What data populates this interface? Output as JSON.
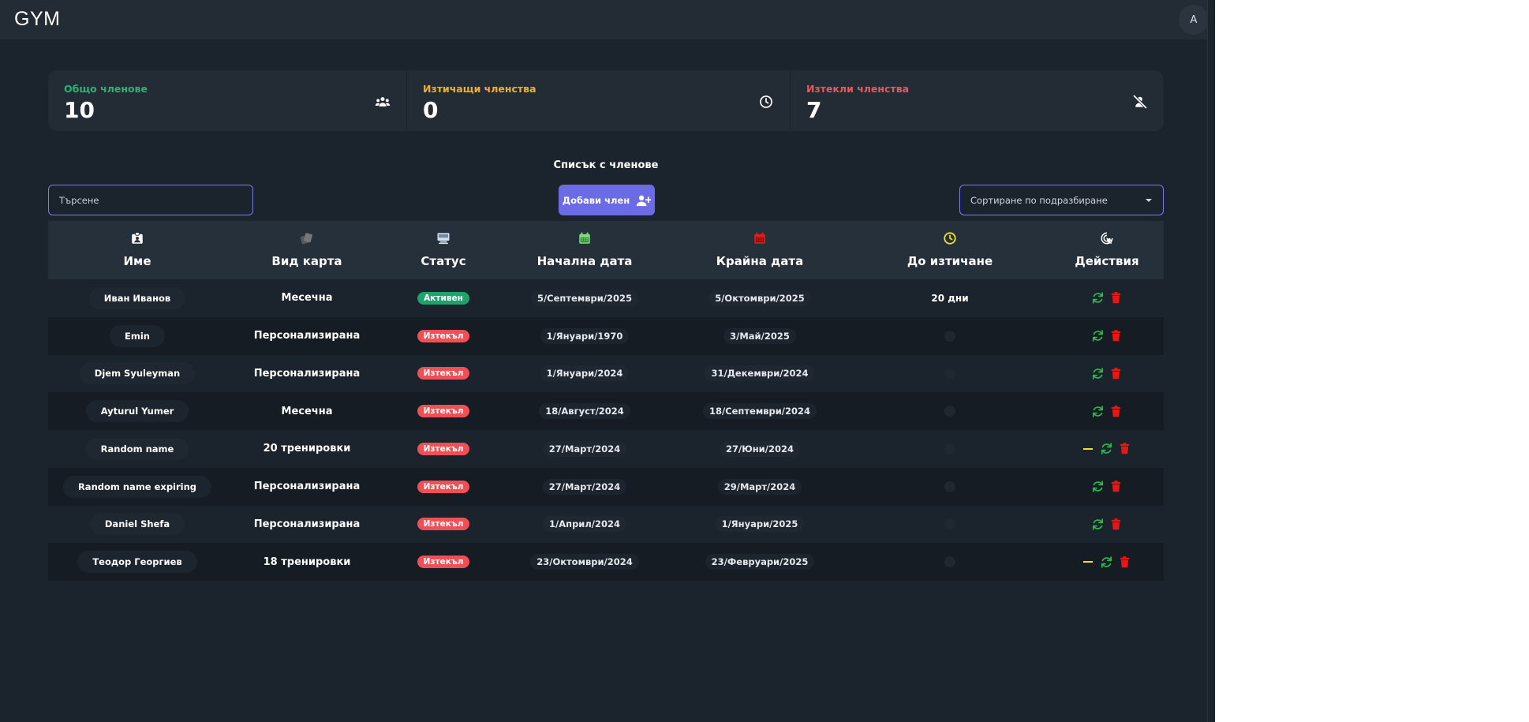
{
  "header": {
    "logo": "GYM",
    "avatar_initial": "A"
  },
  "stats": [
    {
      "label": "Общо членове",
      "value": "10",
      "color": "#27b577",
      "icon": "users-icon"
    },
    {
      "label": "Изтичащи членства",
      "value": "0",
      "color": "#f5b01c",
      "icon": "clock-icon"
    },
    {
      "label": "Изтекли членства",
      "value": "7",
      "color": "#f2545b",
      "icon": "user-slash-icon"
    }
  ],
  "list_title": "Списък с членове",
  "search": {
    "placeholder": "Търсене"
  },
  "add_button": {
    "label": "Добави член"
  },
  "sort": {
    "selected": "Сортиране по подразбиране"
  },
  "columns": [
    {
      "label": "Име",
      "icon": "id-badge-icon",
      "color": "#ffffff"
    },
    {
      "label": "Вид карта",
      "icon": "cards-icon",
      "color": "#6c6f73"
    },
    {
      "label": "Статус",
      "icon": "monitor-icon",
      "color": "#cfe0ee"
    },
    {
      "label": "Начална дата",
      "icon": "calendar-start-icon",
      "color": "#7fe07f"
    },
    {
      "label": "Крайна дата",
      "icon": "calendar-end-icon",
      "color": "#e01c1c"
    },
    {
      "label": "До изтичане",
      "icon": "clock-icon",
      "color": "#f1e51e"
    },
    {
      "label": "Действия",
      "icon": "pointer-click-icon",
      "color": "#ffffff"
    }
  ],
  "status_colors": {
    "Активен": "#1ea36b",
    "Изтекъл": "#ef4f55"
  },
  "rows": [
    {
      "name": "Иван Иванов",
      "card": "Месечна",
      "status": "Активен",
      "start": "5/Септември/2025",
      "end": "5/Октомври/2025",
      "remaining": "20 дни",
      "extra_action": false
    },
    {
      "name": "Emin",
      "card": "Персонализирана",
      "status": "Изтекъл",
      "start": "1/Януари/1970",
      "end": "3/Май/2025",
      "remaining": "",
      "extra_action": false
    },
    {
      "name": "Djem Syuleyman",
      "card": "Персонализирана",
      "status": "Изтекъл",
      "start": "1/Януари/2024",
      "end": "31/Декември/2024",
      "remaining": "",
      "extra_action": false
    },
    {
      "name": "Ayturul Yumer",
      "card": "Месечна",
      "status": "Изтекъл",
      "start": "18/Август/2024",
      "end": "18/Септември/2024",
      "remaining": "",
      "extra_action": false
    },
    {
      "name": "Random name",
      "card": "20 тренировки",
      "status": "Изтекъл",
      "start": "27/Март/2024",
      "end": "27/Юни/2024",
      "remaining": "",
      "extra_action": true
    },
    {
      "name": "Random name expiring",
      "card": "Персонализирана",
      "status": "Изтекъл",
      "start": "27/Март/2024",
      "end": "29/Март/2024",
      "remaining": "",
      "extra_action": false
    },
    {
      "name": "Daniel Shefa",
      "card": "Персонализирана",
      "status": "Изтекъл",
      "start": "1/Април/2024",
      "end": "1/Януари/2025",
      "remaining": "",
      "extra_action": false
    },
    {
      "name": "Теодор Георгиев",
      "card": "18 тренировки",
      "status": "Изтекъл",
      "start": "23/Октомври/2024",
      "end": "23/Февруари/2025",
      "remaining": "",
      "extra_action": true
    }
  ]
}
